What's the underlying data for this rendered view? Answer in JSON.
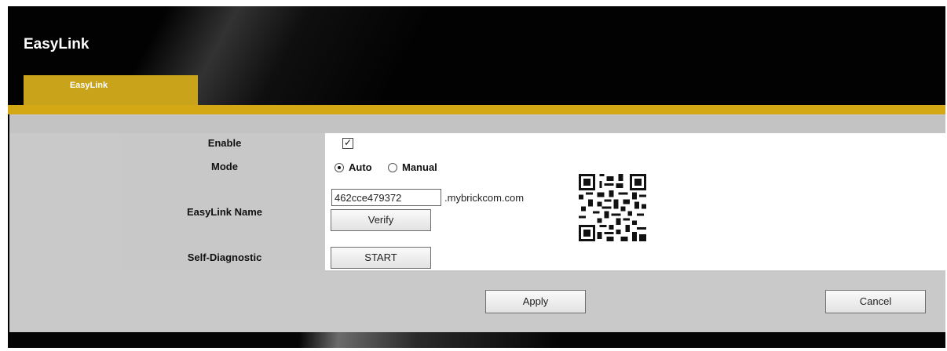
{
  "app": {
    "title": "EasyLink"
  },
  "tabs": [
    {
      "label": "EasyLink",
      "active": true
    }
  ],
  "form": {
    "enable": {
      "label": "Enable",
      "checked": true
    },
    "mode": {
      "label": "Mode",
      "options": [
        {
          "label": "Auto",
          "selected": true
        },
        {
          "label": "Manual",
          "selected": false
        }
      ]
    },
    "easylink_name": {
      "label": "EasyLink Name",
      "value": "462cce479372",
      "domain": ".mybrickcom.com",
      "verify_label": "Verify"
    },
    "self_diagnostic": {
      "label": "Self-Diagnostic",
      "start_label": "START"
    }
  },
  "actions": {
    "apply_label": "Apply",
    "cancel_label": "Cancel"
  },
  "colors": {
    "accent": "#d4a715",
    "tab": "#c9a31a",
    "header": "#020202",
    "panel": "#c9c9c9",
    "label_cell": "#c8c8c8"
  },
  "icons": {
    "qr": "qr-code-icon",
    "check": "checkmark-icon"
  }
}
